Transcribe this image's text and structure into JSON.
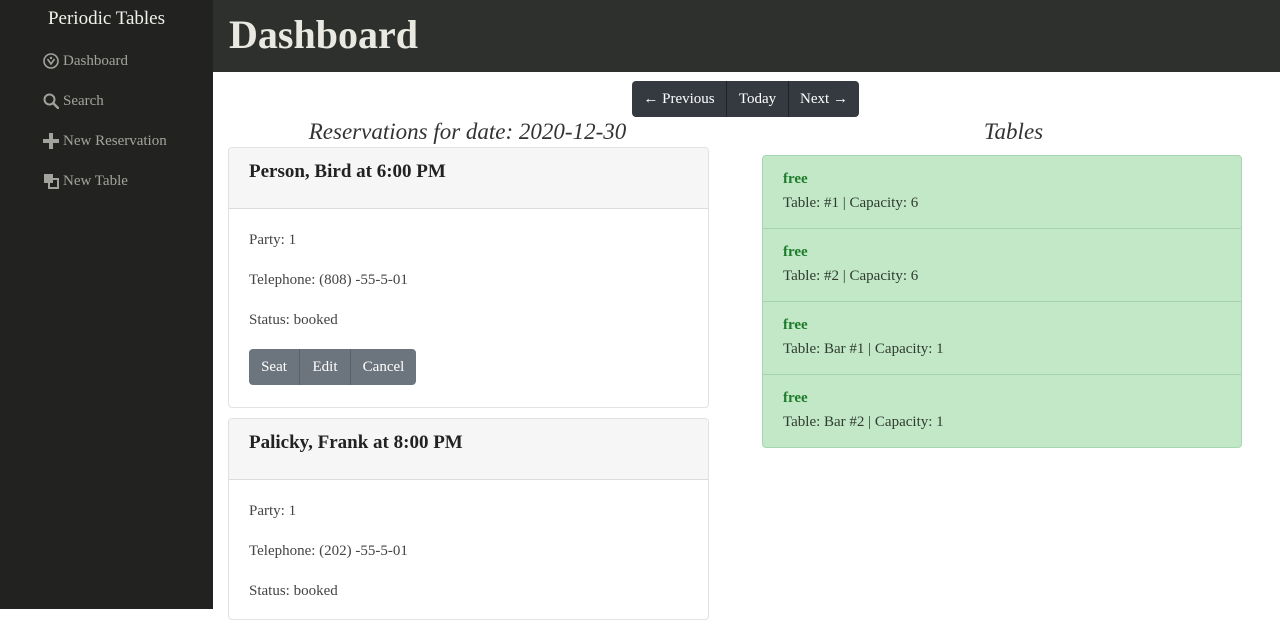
{
  "sidebar": {
    "brand": "Periodic Tables",
    "items": [
      {
        "label": "Dashboard",
        "icon": "dashboard-icon"
      },
      {
        "label": "Search",
        "icon": "search-icon"
      },
      {
        "label": "New Reservation",
        "icon": "plus-icon"
      },
      {
        "label": "New Table",
        "icon": "tables-icon"
      }
    ]
  },
  "header": {
    "title": "Dashboard"
  },
  "date_nav": {
    "previous": "← Previous",
    "today": "Today",
    "next": "Next →"
  },
  "reservations": {
    "heading": "Reservations for date: 2020-12-30",
    "items": [
      {
        "title": "Person, Bird at 6:00 PM",
        "party": "Party: 1",
        "telephone": "Telephone: (808) -55-5-01",
        "status": "Status: booked",
        "actions": {
          "seat": "Seat",
          "edit": "Edit",
          "cancel": "Cancel"
        }
      },
      {
        "title": "Palicky, Frank at 8:00 PM",
        "party": "Party: 1",
        "telephone": "Telephone: (202) -55-5-01",
        "status": "Status: booked"
      }
    ]
  },
  "tables": {
    "heading": "Tables",
    "items": [
      {
        "status": "free",
        "info": "Table: #1 | Capacity: 6"
      },
      {
        "status": "free",
        "info": "Table: #2 | Capacity: 6"
      },
      {
        "status": "free",
        "info": "Table: Bar #1 | Capacity: 1"
      },
      {
        "status": "free",
        "info": "Table: Bar #2 | Capacity: 1"
      }
    ]
  },
  "colors": {
    "sidebar_bg": "#222320",
    "topbar_bg": "#2e302d",
    "nav_button": "#343a40",
    "action_button": "#6c757d",
    "table_free_bg": "#c3e8c8",
    "table_free_text": "#1e7b2b"
  }
}
